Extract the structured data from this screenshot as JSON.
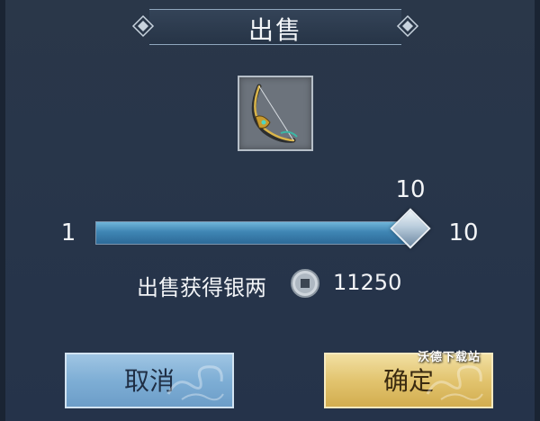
{
  "dialog": {
    "title": "出售"
  },
  "item": {
    "icon": "bow-weapon-icon"
  },
  "quantity": {
    "current": "10",
    "min": "1",
    "max": "10",
    "fraction": 1.0
  },
  "earnings": {
    "label": "出售获得银两",
    "currency_icon": "silver-coin-icon",
    "amount": "11250"
  },
  "buttons": {
    "cancel": "取消",
    "confirm": "确定"
  },
  "watermark": "沃德下载站",
  "colors": {
    "slider_fill": "#3f85b3",
    "cancel_button": "#7eaed5",
    "confirm_button": "#e2c46f"
  }
}
